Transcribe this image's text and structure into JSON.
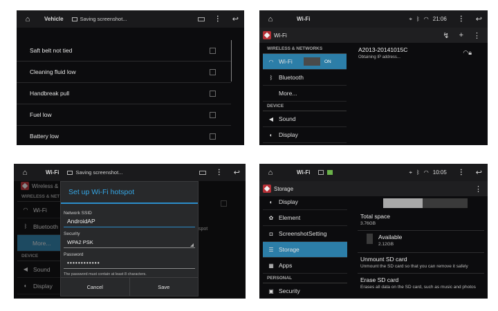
{
  "panel1": {
    "status": {
      "title": "Vehicle",
      "notification": "Saving screenshot..."
    },
    "items": [
      {
        "label": "Saft belt not tied"
      },
      {
        "label": "Cleaning fluid low"
      },
      {
        "label": "Handbreak pull"
      },
      {
        "label": "Fuel low"
      },
      {
        "label": "Battery low"
      }
    ]
  },
  "panel2": {
    "status": {
      "title": "Wi-Fi",
      "time": "21:06"
    },
    "actionbar": {
      "title": "Wi-Fi"
    },
    "sections": {
      "wireless": "WIRELESS & NETWORKS",
      "device": "DEVICE"
    },
    "nav": [
      {
        "label": "Wi-Fi",
        "toggle": "ON"
      },
      {
        "label": "Bluetooth"
      },
      {
        "label": "More..."
      },
      {
        "label": "Sound"
      },
      {
        "label": "Display"
      }
    ],
    "network": {
      "ssid": "A2013-20141015C",
      "status": "Obtaining IP address..."
    }
  },
  "panel3": {
    "status": {
      "title": "Wi-Fi",
      "notification": "Saving screenshot..."
    },
    "background": {
      "title": "Wireless & n",
      "section": "WIRELESS & NET",
      "device": "DEVICE",
      "items": [
        "Wi-Fi",
        "Bluetooth",
        "More...",
        "Sound",
        "Display"
      ],
      "ghost_text": "spot"
    },
    "dialog": {
      "title": "Set up Wi-Fi hotspot",
      "ssid_label": "Network SSID",
      "ssid_value": "AndroidAP",
      "security_label": "Security",
      "security_value": "WPA2 PSK",
      "password_label": "Password",
      "password_value": "••••••••••••",
      "hint": "The password must contain at least 8 characters.",
      "cancel": "Cancel",
      "save": "Save"
    }
  },
  "panel4": {
    "status": {
      "title": "Wi-Fi",
      "time": "10:05"
    },
    "actionbar": {
      "title": "Storage"
    },
    "nav": [
      {
        "label": "Display"
      },
      {
        "label": "Element"
      },
      {
        "label": "ScreenshotSetting"
      },
      {
        "label": "Storage"
      },
      {
        "label": "Apps"
      }
    ],
    "section": "PERSONAL",
    "nav_personal": "Security",
    "storage": {
      "used_fraction": 0.47,
      "total_label": "Total space",
      "total_value": "3.76GB",
      "available_label": "Available",
      "available_value": "2.12GB",
      "unmount_title": "Unmount SD card",
      "unmount_desc": "Unmount the SD card so that you can remove it safely",
      "erase_title": "Erase SD card",
      "erase_desc": "Erases all data on the SD card, such as music and photos"
    }
  }
}
